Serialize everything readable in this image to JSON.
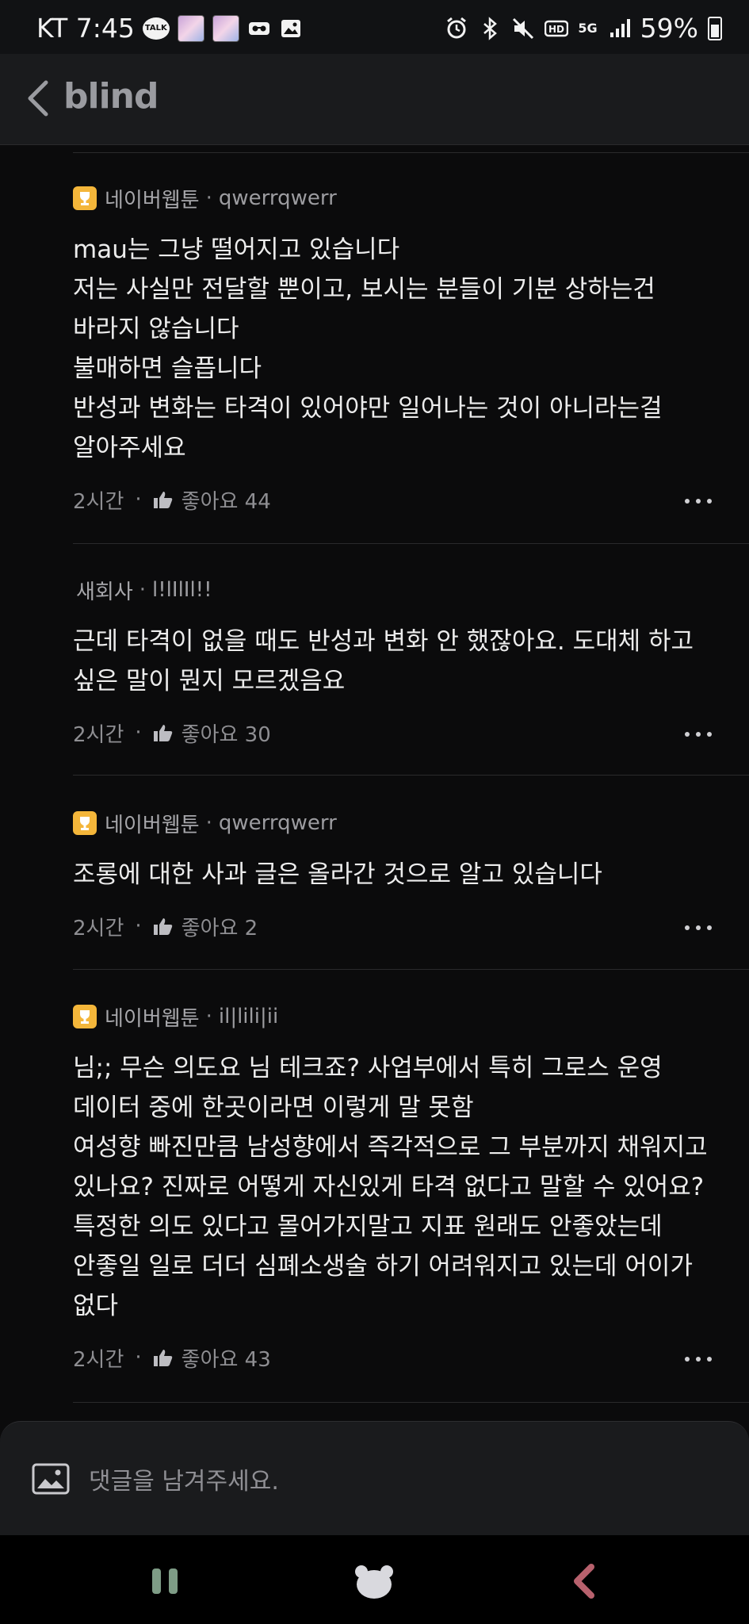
{
  "statusbar": {
    "carrier_time": "KT 7:45",
    "talk_label": "TALK",
    "network": "5G",
    "battery": "59%"
  },
  "header": {
    "brand": "blind"
  },
  "comments": [
    {
      "company": "네이버웹툰",
      "author": "qwerrqwerr",
      "has_trophy": true,
      "body": "mau는 그냥 떨어지고 있습니다\n저는 사실만 전달할 뿐이고, 보시는 분들이 기분 상하는건\n바라지 않습니다\n불매하면 슬픕니다\n반성과 변화는 타격이 있어야만 일어나는 것이 아니라는걸\n알아주세요",
      "time": "2시간",
      "likes": "좋아요 44"
    },
    {
      "company": "새회사",
      "author": "l!lIlIl!!",
      "has_trophy": false,
      "body": "근데 타격이 없을 때도 반성과 변화 안 했잖아요. 도대체 하고\n싶은 말이 뭔지 모르겠음요",
      "time": "2시간",
      "likes": "좋아요 30"
    },
    {
      "company": "네이버웹툰",
      "author": "qwerrqwerr",
      "has_trophy": true,
      "body": "조롱에 대한 사과 글은 올라간 것으로 알고 있습니다",
      "time": "2시간",
      "likes": "좋아요 2"
    },
    {
      "company": "네이버웹툰",
      "author": "il|lili|ii",
      "has_trophy": true,
      "body": "님;; 무슨 의도요 님 테크죠? 사업부에서 특히 그로스 운영\n데이터 중에 한곳이라면 이렇게 말 못함\n여성향 빠진만큼 남성향에서 즉각적으로 그 부분까지 채워지고\n있나요? 진짜로 어떻게 자신있게 타격 없다고 말할 수 있어요?\n특정한 의도 있다고 몰어가지말고 지표 원래도 안좋았는데\n안좋일 일로 더더 심폐소생술 하기 어려워지고 있는데 어이가\n없다",
      "time": "2시간",
      "likes": "좋아요 43"
    }
  ],
  "input": {
    "placeholder": "댓글을 남겨주세요."
  },
  "colors": {
    "background": "#0b0b0c",
    "header": "#1a1b1d",
    "trophy": "#f4b63a",
    "text": "#ececec",
    "muted": "#8e8e92"
  }
}
